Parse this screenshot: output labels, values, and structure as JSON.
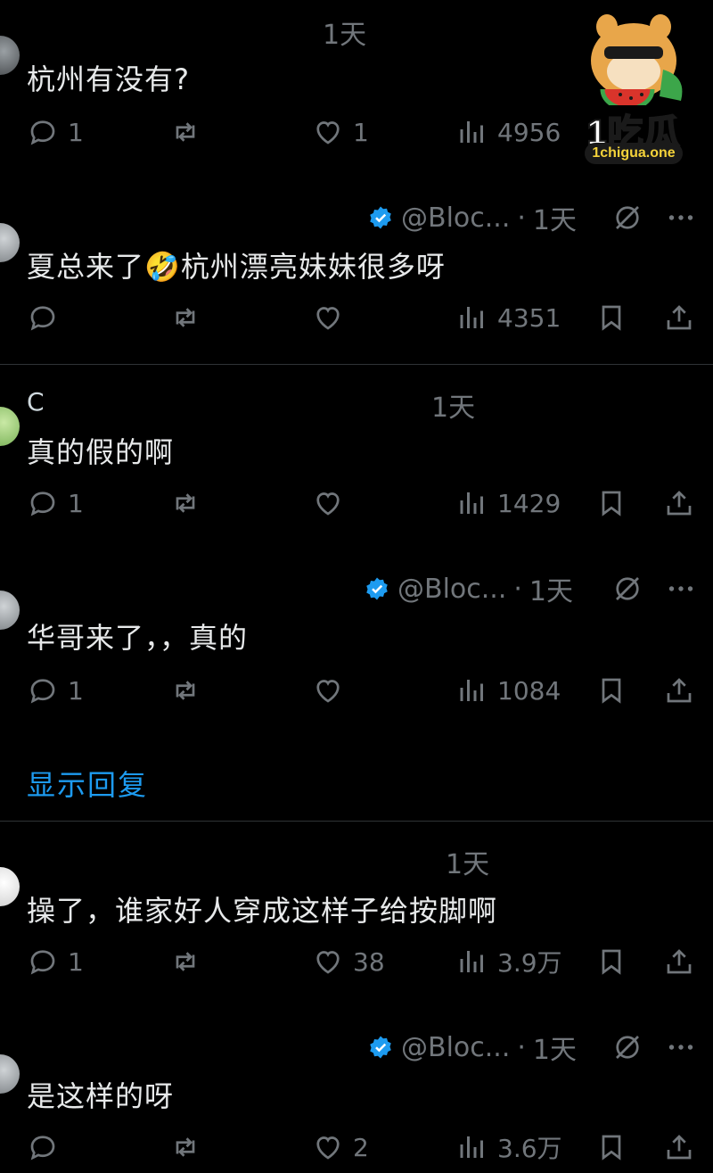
{
  "brand": {
    "title": "1吃瓜",
    "subtitle": "1chigua.one"
  },
  "tweets": [
    {
      "time": "1天",
      "text": "杭州有没有?",
      "reply_count": "1",
      "like_count": "1",
      "views": "4956"
    },
    {
      "handle": "@Bloc...",
      "time": "1天",
      "text": "夏总来了🤣杭州漂亮妹妹很多呀",
      "reply_count": "",
      "like_count": "",
      "views": "4351"
    },
    {
      "name": "C",
      "time": "1天",
      "text": "真的假的啊",
      "reply_count": "1",
      "like_count": "",
      "views": "1429"
    },
    {
      "handle": "@Bloc...",
      "time": "1天",
      "text": "华哥来了，，真的",
      "reply_count": "1",
      "like_count": "",
      "views": "1084"
    },
    {
      "time": "1天",
      "text": "操了，谁家好人穿成这样子给按脚啊",
      "reply_count": "1",
      "like_count": "38",
      "views": "3.9万"
    },
    {
      "handle": "@Bloc...",
      "time": "1天",
      "text": "是这样的呀",
      "reply_count": "",
      "like_count": "2",
      "views": "3.6万"
    }
  ],
  "show_replies": "显示回复",
  "icons": {
    "reply": "reply-icon",
    "retweet": "retweet-icon",
    "like": "heart-icon",
    "views": "views-icon",
    "bookmark": "bookmark-icon",
    "share": "share-icon",
    "verified": "verified-badge-icon",
    "grok": "grok-icon",
    "more": "more-icon"
  },
  "colors": {
    "background": "#000000",
    "text": "#e7e9ea",
    "muted": "#71767b",
    "accent": "#1d9bf0"
  }
}
